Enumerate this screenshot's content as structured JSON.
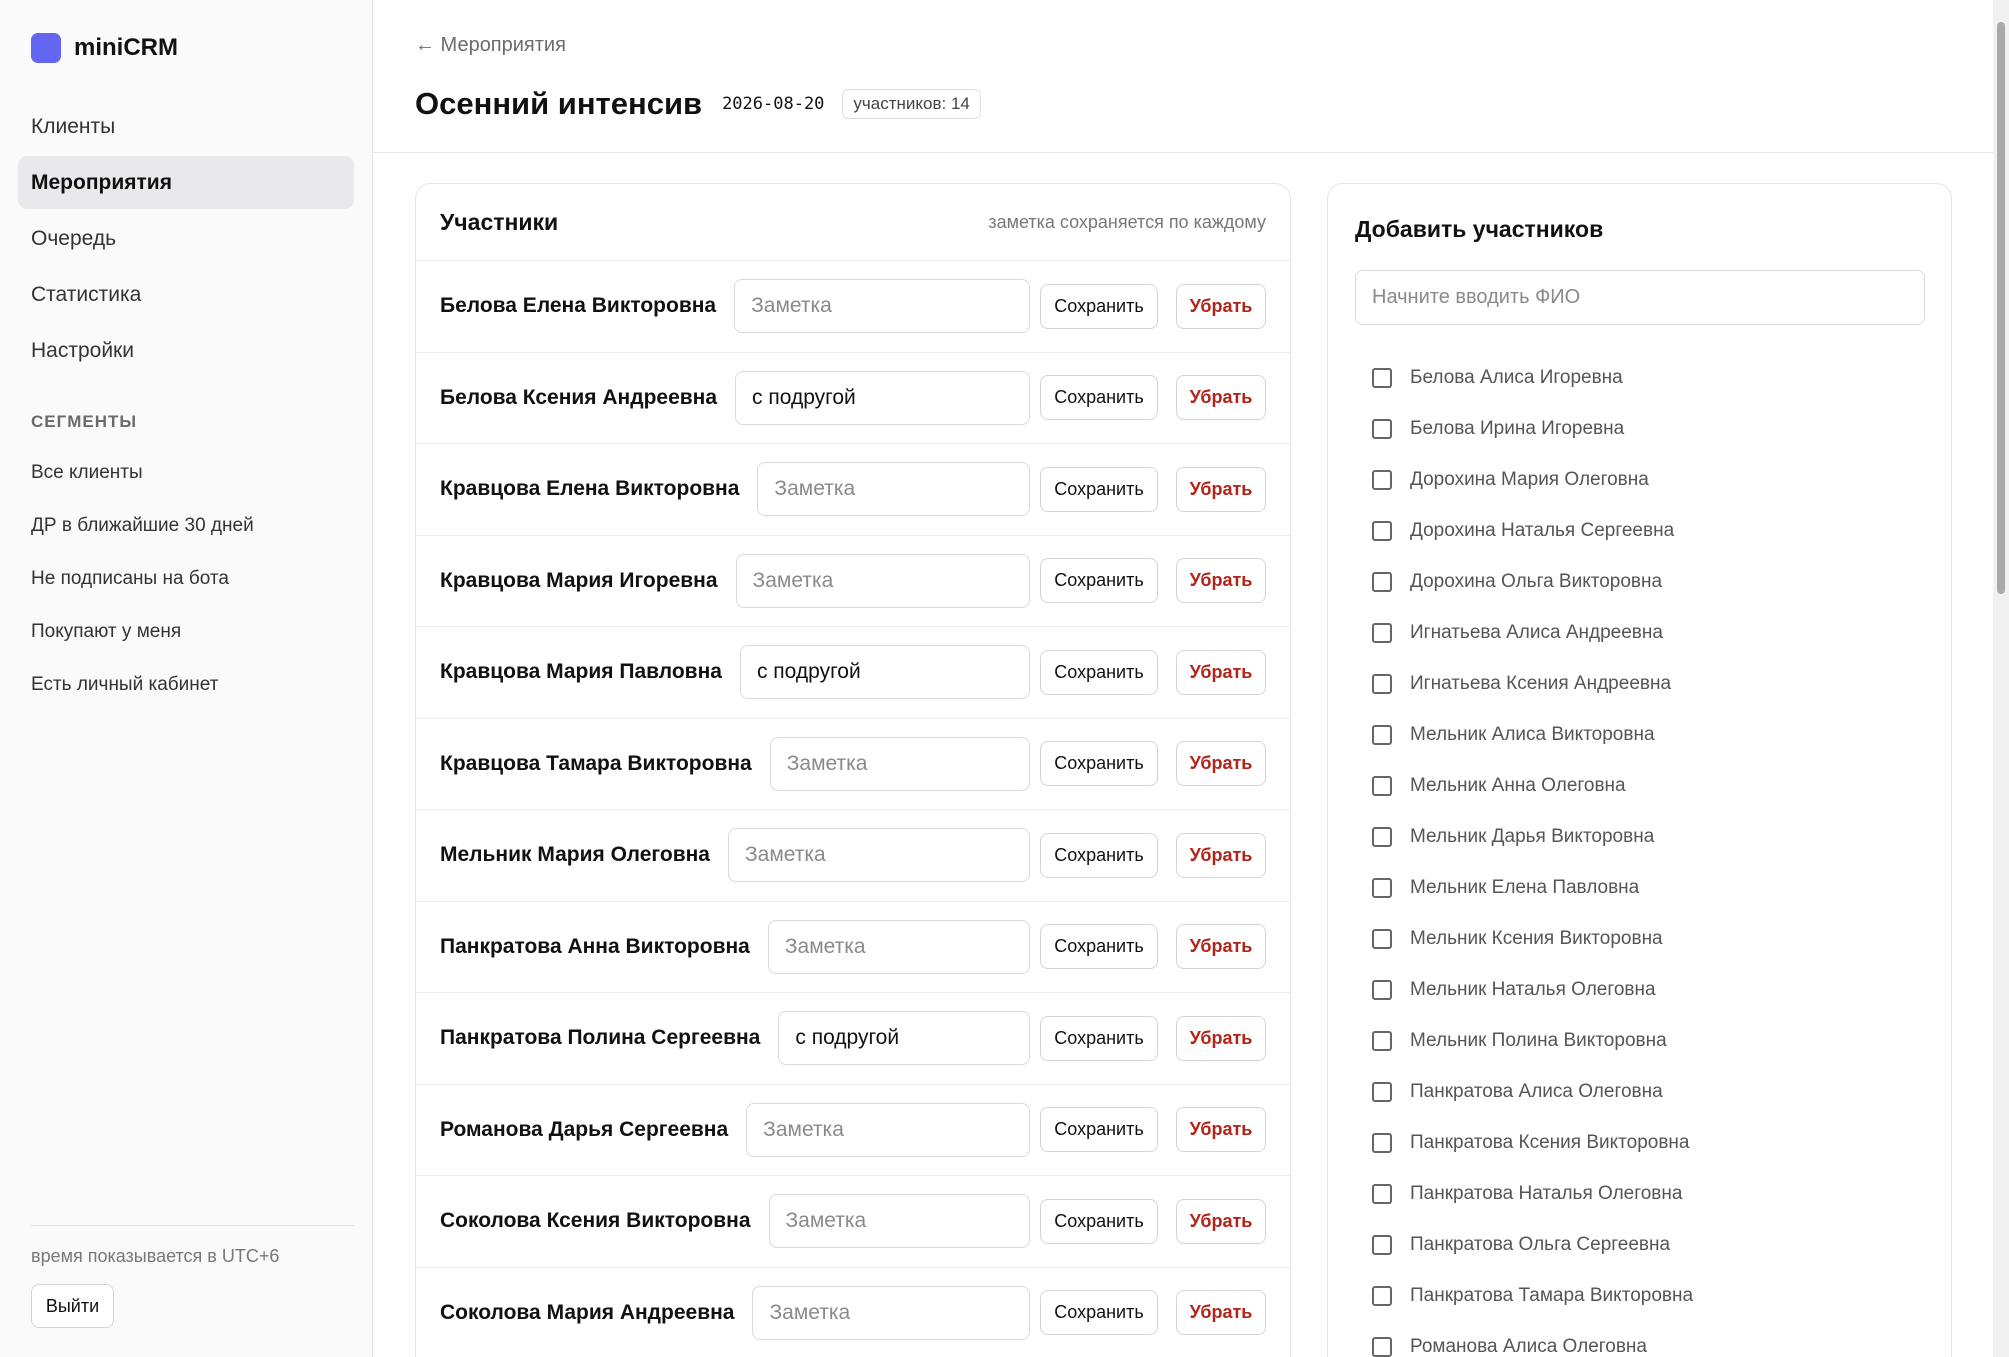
{
  "brand": {
    "name": "miniCRM",
    "logo_color": "#6366f1"
  },
  "nav": [
    {
      "label": "Клиенты",
      "active": false
    },
    {
      "label": "Мероприятия",
      "active": true
    },
    {
      "label": "Очередь",
      "active": false
    },
    {
      "label": "Статистика",
      "active": false
    },
    {
      "label": "Настройки",
      "active": false
    }
  ],
  "segments": {
    "title": "СЕГМЕНТЫ",
    "items": [
      "Все клиенты",
      "ДР в ближайшие 30 дней",
      "Не подписаны на бота",
      "Покупают у меня",
      "Есть личный кабинет"
    ]
  },
  "footer": {
    "timezone_note": "время показывается в UTC+6",
    "logout_label": "Выйти"
  },
  "header": {
    "back_label": "← Мероприятия",
    "title": "Осенний интенсив",
    "date": "2026-08-20",
    "count_badge": "участников: 14"
  },
  "participants": {
    "title": "Участники",
    "hint": "заметка сохраняется по каждому",
    "note_placeholder": "Заметка",
    "save_label": "Сохранить",
    "remove_label": "Убрать",
    "rows": [
      {
        "name": "Белова Елена Викторовна",
        "note": ""
      },
      {
        "name": "Белова Ксения Андреевна",
        "note": "с подругой"
      },
      {
        "name": "Кравцова Елена Викторовна",
        "note": ""
      },
      {
        "name": "Кравцова Мария Игоревна",
        "note": ""
      },
      {
        "name": "Кравцова Мария Павловна",
        "note": "с подругой"
      },
      {
        "name": "Кравцова Тамара Викторовна",
        "note": ""
      },
      {
        "name": "Мельник Мария Олеговна",
        "note": ""
      },
      {
        "name": "Панкратова Анна Викторовна",
        "note": ""
      },
      {
        "name": "Панкратова Полина Сергеевна",
        "note": "с подругой"
      },
      {
        "name": "Романова Дарья Сергеевна",
        "note": ""
      },
      {
        "name": "Соколова Ксения Викторовна",
        "note": ""
      },
      {
        "name": "Соколова Мария Андреевна",
        "note": ""
      }
    ]
  },
  "add_panel": {
    "title": "Добавить участников",
    "search_placeholder": "Начните вводить ФИО",
    "candidates": [
      "Белова Алиса Игоревна",
      "Белова Ирина Игоревна",
      "Дорохина Мария Олеговна",
      "Дорохина Наталья Сергеевна",
      "Дорохина Ольга Викторовна",
      "Игнатьева Алиса Андреевна",
      "Игнатьева Ксения Андреевна",
      "Мельник Алиса Викторовна",
      "Мельник Анна Олеговна",
      "Мельник Дарья Викторовна",
      "Мельник Елена Павловна",
      "Мельник Ксения Викторовна",
      "Мельник Наталья Олеговна",
      "Мельник Полина Викторовна",
      "Панкратова Алиса Олеговна",
      "Панкратова Ксения Викторовна",
      "Панкратова Наталья Олеговна",
      "Панкратова Ольга Сергеевна",
      "Панкратова Тамара Викторовна",
      "Романова Алиса Олеговна"
    ]
  },
  "colors": {
    "accent": "#6366f1",
    "danger": "#b42318",
    "active_nav_bg": "#e9e9eb"
  }
}
